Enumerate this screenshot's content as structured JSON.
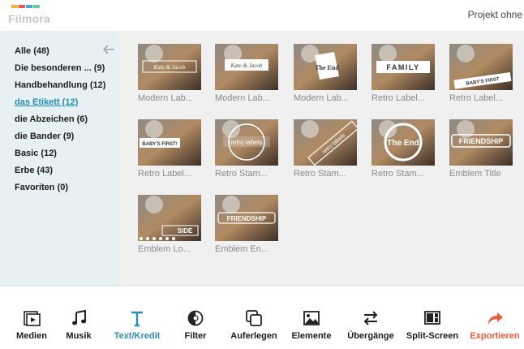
{
  "app": {
    "logo_text": "Filmora",
    "project_title": "Projekt ohne"
  },
  "colors": {
    "accent": "#1f8fb3",
    "export": "#ee5a3e",
    "sidebar_bg": "#e7f0f3",
    "logo_bars": [
      "#f5b335",
      "#e9594f",
      "#3fa9d4",
      "#6bc2b3"
    ]
  },
  "sidebar": {
    "back_icon": "arrow-left-icon",
    "items": [
      {
        "label": "Alle (48)",
        "active": false
      },
      {
        "label": "Die besonderen ... (9)",
        "active": false
      },
      {
        "label": "Handbehandlung (12)",
        "active": false
      },
      {
        "label": "das Etikett (12)",
        "active": true
      },
      {
        "label": "die Abzeichen (6)",
        "active": false
      },
      {
        "label": "die Bander (9)",
        "active": false
      },
      {
        "label": "Basic (12)",
        "active": false
      },
      {
        "label": "Erbe (43)",
        "active": false
      },
      {
        "label": "Favoriten (0)",
        "active": false
      }
    ]
  },
  "titles": [
    {
      "label": "Modern Lab...",
      "overlay": "Kate & Jacob"
    },
    {
      "label": "Modern Lab...",
      "overlay": "Kate & Jacob"
    },
    {
      "label": "Modern Lab...",
      "overlay": "The End"
    },
    {
      "label": "Retro Label...",
      "overlay": "FAMILY"
    },
    {
      "label": "Retro Label...",
      "overlay": "BABY'S FIRST"
    },
    {
      "label": "Retro Label...",
      "overlay": "BABY'S FIRST!"
    },
    {
      "label": "Retro Stam...",
      "overlay": "retro labels"
    },
    {
      "label": "Retro Stam...",
      "overlay": "retro labels"
    },
    {
      "label": "Retro Stam...",
      "overlay": "The End"
    },
    {
      "label": "Emblem Title",
      "overlay": "FRIENDSHIP"
    },
    {
      "label": "Emblem Lo...",
      "overlay": "SIDE"
    },
    {
      "label": "Emblem En...",
      "overlay": "FRIENDSHIP"
    }
  ],
  "toolbar": {
    "items": [
      {
        "label": "Medien",
        "icon": "media-icon"
      },
      {
        "label": "Musik",
        "icon": "music-note-icon"
      },
      {
        "label": "Text/Kredit",
        "icon": "text-t-icon",
        "active": true
      },
      {
        "label": "Filter",
        "icon": "filter-icon"
      },
      {
        "label": "Auferlegen",
        "icon": "overlay-icon"
      },
      {
        "label": "Elemente",
        "icon": "image-icon"
      },
      {
        "label": "Übergänge",
        "icon": "transition-arrows-icon"
      },
      {
        "label": "Split-Screen",
        "icon": "split-screen-icon"
      },
      {
        "label": "Exportieren",
        "icon": "export-arrow-icon"
      }
    ]
  }
}
